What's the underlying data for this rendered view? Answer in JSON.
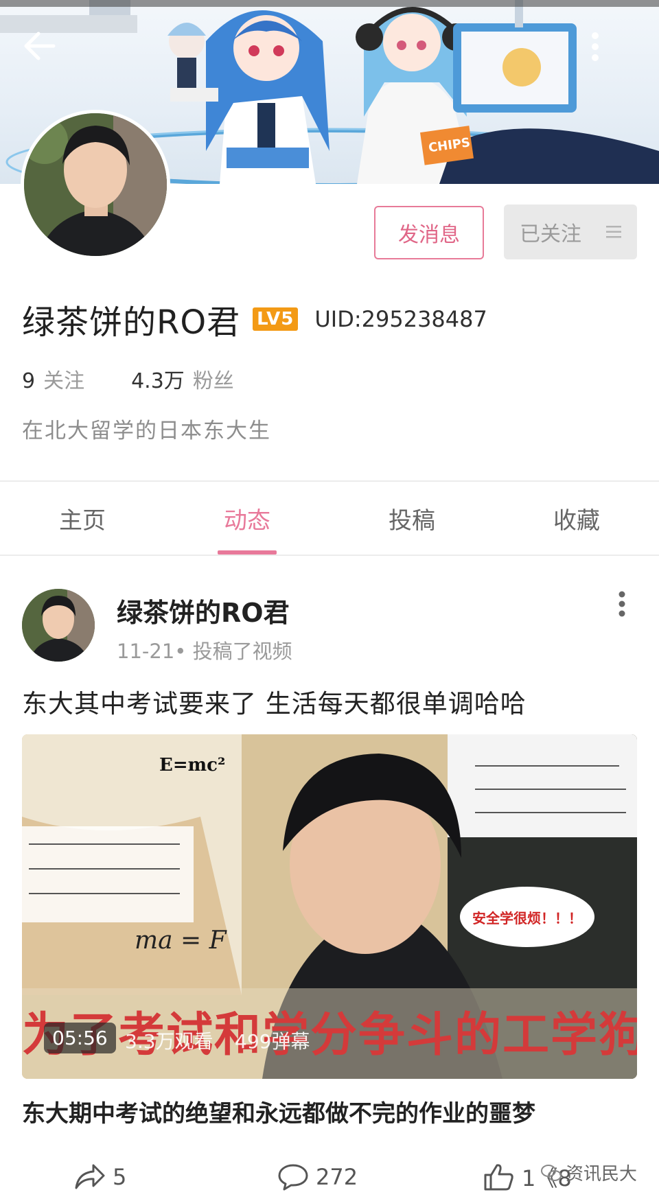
{
  "profile": {
    "name": "绿茶饼的RO君",
    "level_badge": "LV5",
    "uid": "UID:295238487",
    "following_count": "9",
    "following_label": "关注",
    "followers_count": "4.3万",
    "followers_label": "粉丝",
    "bio": "在北大留学的日本东大生"
  },
  "actions": {
    "message_label": "发消息",
    "follow_label": "已关注"
  },
  "tabs": [
    {
      "label": "主页",
      "active": false
    },
    {
      "label": "动态",
      "active": true
    },
    {
      "label": "投稿",
      "active": false
    },
    {
      "label": "收藏",
      "active": false
    }
  ],
  "post": {
    "author": "绿茶饼的RO君",
    "meta": "11-21• 投稿了视频",
    "text": "东大其中考试要来了 生活每天都很单调哈哈",
    "video": {
      "duration": "05:56",
      "views": "3.3万观看",
      "danmaku": "499弹幕",
      "thumbnail_caption": "为了考试和学分争斗的工学狗",
      "thumbnail_formula_top": "E=mc²",
      "thumbnail_formula_bottom": "ma = F",
      "thumbnail_speech": "安全学很烦！！！"
    },
    "video_title": "东大期中考试的绝望和永远都做不完的作业的噩梦",
    "share_count": "5",
    "comment_count": "272",
    "like_count": "1《8"
  },
  "watermark": "资讯民大",
  "colors": {
    "accent_pink": "#e8799a",
    "badge_orange": "#f39a15",
    "thumbnail_caption_red": "#d43a3a"
  },
  "icons": {
    "back": "arrow-left-icon",
    "more": "more-vertical-icon",
    "follow_menu": "menu-lines-icon",
    "share": "share-arrow-icon",
    "comment": "comment-bubble-icon",
    "like": "thumbs-up-icon"
  }
}
